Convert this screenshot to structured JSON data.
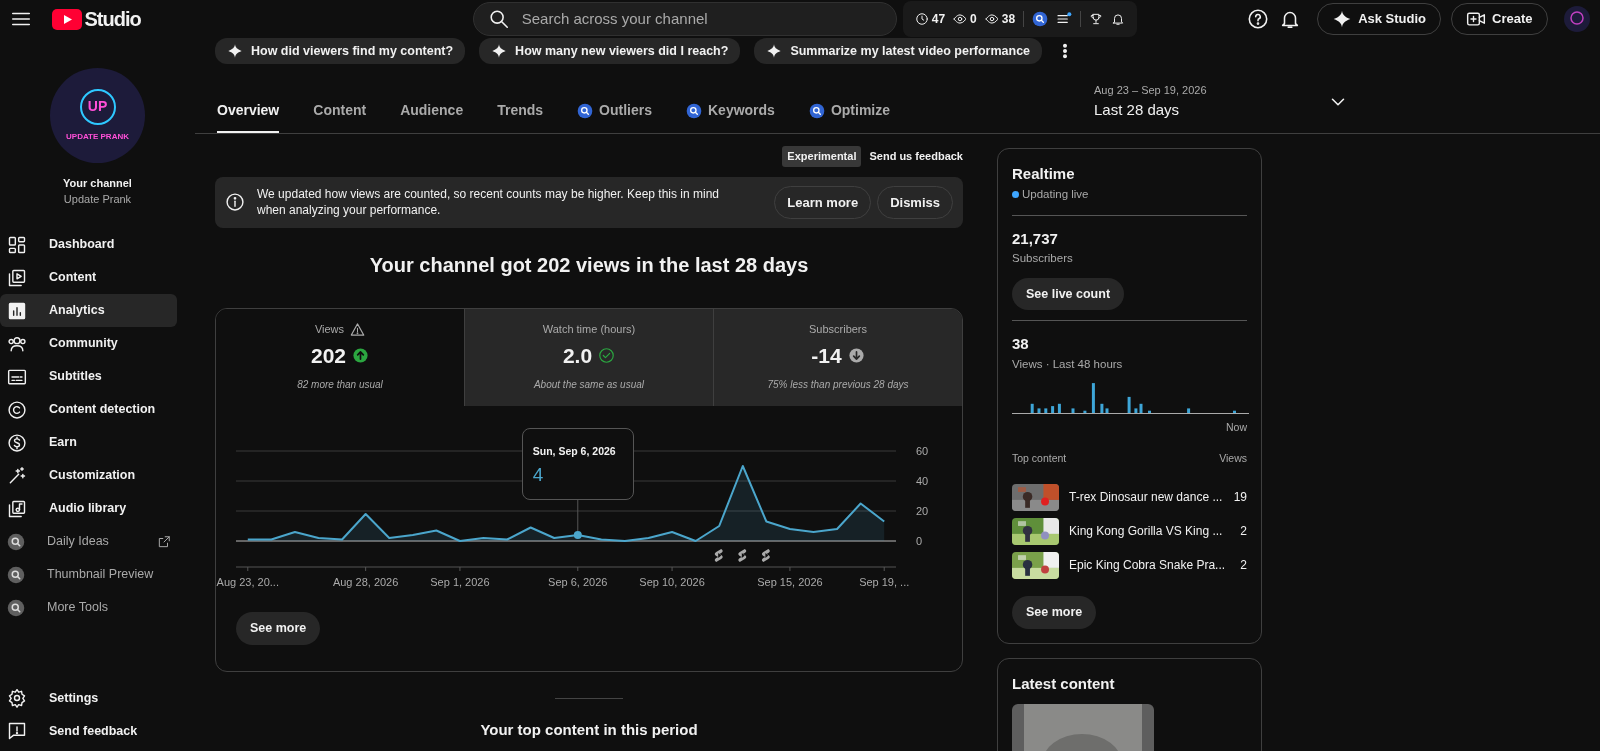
{
  "header": {
    "logo_text": "Studio",
    "search": {
      "placeholder": "Search across your channel"
    },
    "stats": [
      {
        "kind": "clock",
        "value": "47"
      },
      {
        "kind": "eye",
        "value": "0"
      },
      {
        "kind": "eye",
        "value": "38"
      }
    ],
    "ask_button": "Ask Studio",
    "create_button": "Create"
  },
  "channel": {
    "avatar_badge": "UP",
    "avatar_text": "UPDATE PRANK",
    "title": "Your channel",
    "name": "Update Prank"
  },
  "sidebar": {
    "items": [
      {
        "kind": "dashboard",
        "label": "Dashboard",
        "selected": false
      },
      {
        "kind": "content",
        "label": "Content",
        "selected": false
      },
      {
        "kind": "analytics",
        "label": "Analytics",
        "selected": true
      },
      {
        "kind": "community",
        "label": "Community",
        "selected": false
      },
      {
        "kind": "subtitles",
        "label": "Subtitles",
        "selected": false
      },
      {
        "kind": "copyright",
        "label": "Content detection",
        "selected": false
      },
      {
        "kind": "earn",
        "label": "Earn",
        "selected": false
      },
      {
        "kind": "customization",
        "label": "Customization",
        "selected": false
      },
      {
        "kind": "audio",
        "label": "Audio library",
        "selected": false
      },
      {
        "kind": "extension",
        "label": "Daily Ideas",
        "selected": false,
        "external": true
      },
      {
        "kind": "extension",
        "label": "Thumbnail Preview",
        "selected": false,
        "external": false
      },
      {
        "kind": "extension",
        "label": "More Tools",
        "selected": false,
        "external": false
      }
    ],
    "footer": [
      {
        "kind": "settings",
        "label": "Settings"
      },
      {
        "kind": "feedback",
        "label": "Send feedback"
      }
    ]
  },
  "suggestions": [
    "How did viewers find my content?",
    "How many new viewers did I reach?",
    "Summarize my latest video performance"
  ],
  "tabs": [
    {
      "label": "Overview",
      "selected": true,
      "kind": "plain"
    },
    {
      "label": "Content",
      "selected": false,
      "kind": "plain"
    },
    {
      "label": "Audience",
      "selected": false,
      "kind": "plain"
    },
    {
      "label": "Trends",
      "selected": false,
      "kind": "plain"
    },
    {
      "label": "Outliers",
      "selected": false,
      "kind": "extension"
    },
    {
      "label": "Keywords",
      "selected": false,
      "kind": "extension"
    },
    {
      "label": "Optimize",
      "selected": false,
      "kind": "extension"
    }
  ],
  "date_range": {
    "range": "Aug 23 – Sep 19, 2026",
    "label": "Last 28 days"
  },
  "feedback_bar": {
    "tag": "Experimental",
    "link": "Send us feedback"
  },
  "notice": {
    "text": "We updated how views are counted, so recent counts may be higher. Keep this in mind when analyzing your performance.",
    "buttons": [
      "Learn more",
      "Dismiss"
    ]
  },
  "headline": "Your channel got 202 views in the last 28 days",
  "metrics": [
    {
      "label": "Views",
      "warning": true,
      "value": "202",
      "kind": "up",
      "note": "82 more than usual",
      "selected": true
    },
    {
      "label": "Watch time (hours)",
      "warning": false,
      "value": "2.0",
      "kind": "same",
      "note": "About the same as usual",
      "selected": false
    },
    {
      "label": "Subscribers",
      "warning": false,
      "value": "-14",
      "kind": "down",
      "note": "75% less than previous 28 days",
      "selected": false
    }
  ],
  "chart": {
    "chart_data": {
      "type": "area",
      "categories": [
        "Aug 23, 20...",
        null,
        null,
        null,
        null,
        "Aug 28, 2026",
        null,
        null,
        null,
        "Sep 1, 2026",
        null,
        null,
        null,
        null,
        "Sep 6, 2026",
        null,
        null,
        null,
        "Sep 10, 2026",
        null,
        null,
        null,
        null,
        "Sep 15, 2026",
        null,
        null,
        null,
        "Sep 19, ..."
      ],
      "series": [
        {
          "color": "#4ba6cc",
          "values": [
            1,
            1,
            6,
            2,
            1,
            18,
            2,
            4,
            7,
            0,
            2,
            1,
            9,
            2,
            4,
            1,
            0,
            2,
            6,
            0,
            10,
            50,
            13,
            8,
            6,
            8,
            25,
            13
          ]
        }
      ],
      "ylim": [
        0,
        60
      ],
      "yticks": [
        0,
        20,
        40,
        60
      ]
    },
    "tooltip": {
      "date": "Sun, Sep 6, 2026",
      "value": "4"
    }
  },
  "chart_button": "See more",
  "top_content_heading": "Your top content in this period",
  "realtime": {
    "title": "Realtime",
    "status": "Updating live",
    "subscribers": "21,737",
    "subscribers_label": "Subscribers",
    "live_button": "See live count",
    "views": "38",
    "views_label": "Views · Last 48 hours",
    "sparkline_end": "Now",
    "columns": [
      "Top content",
      "Views"
    ],
    "rows": [
      {
        "title": "T-rex Dinosaur new dance ...",
        "views": "19"
      },
      {
        "title": "King Kong Gorilla VS King ...",
        "views": "2"
      },
      {
        "title": "Epic King Cobra Snake Pra...",
        "views": "2"
      }
    ],
    "see_more": "See more"
  },
  "latest_content": {
    "title": "Latest content"
  }
}
